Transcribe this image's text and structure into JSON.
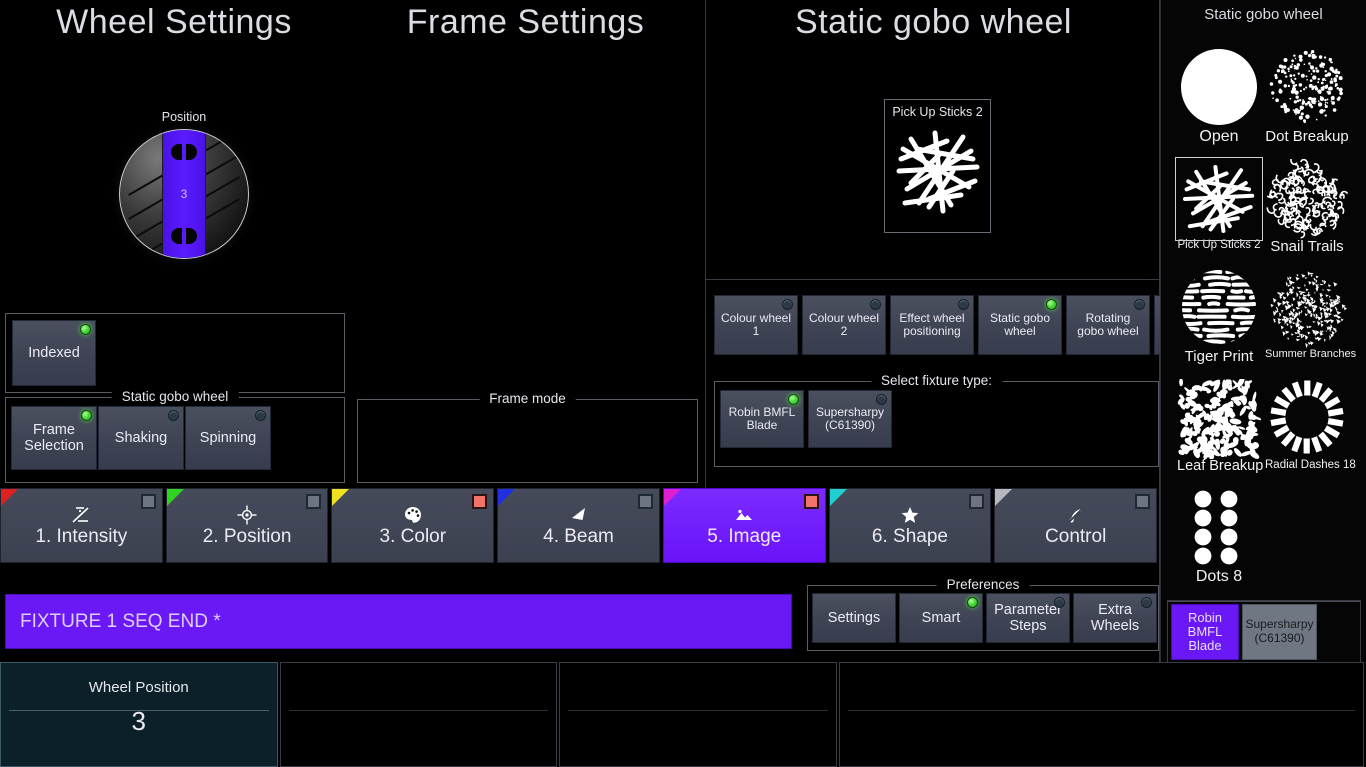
{
  "panels": {
    "wheel_settings": {
      "title": "Wheel Settings"
    },
    "frame_settings": {
      "title": "Frame Settings"
    },
    "static_gobo_wheel": {
      "title": "Static gobo wheel"
    }
  },
  "wheel": {
    "label": "Position",
    "value": "3",
    "highlight_color": "#5a1bff"
  },
  "wheel_mode_group": {
    "buttons": [
      {
        "label": "Indexed",
        "led": "on"
      }
    ]
  },
  "static_gobo_group": {
    "caption": "Static gobo wheel",
    "buttons": [
      {
        "label": "Frame Selection",
        "led": "on"
      },
      {
        "label": "Shaking",
        "led": "off"
      },
      {
        "label": "Spinning",
        "led": "off"
      }
    ]
  },
  "frame_mode_group": {
    "caption": "Frame mode",
    "buttons": []
  },
  "gobo_preview": {
    "name": "Pick Up Sticks 2"
  },
  "wheel_selector": {
    "buttons": [
      {
        "label": "Colour wheel 1",
        "led": "off"
      },
      {
        "label": "Colour wheel 2",
        "led": "off"
      },
      {
        "label": "Effect wheel positioning",
        "led": "off"
      },
      {
        "label": "Static gobo wheel",
        "led": "on"
      },
      {
        "label": "Rotating gobo wheel",
        "led": "off"
      },
      {
        "label": "",
        "led": "none"
      }
    ]
  },
  "fixture_type_group": {
    "caption": "Select fixture type:",
    "buttons": [
      {
        "label": "Robin BMFL Blade",
        "led": "on"
      },
      {
        "label": "Supersharpy (C61390)",
        "led": "off"
      }
    ]
  },
  "sidebar": {
    "title": "Static gobo wheel",
    "gobos": [
      {
        "name": "Open",
        "art": "open",
        "selected": false,
        "font": 16
      },
      {
        "name": "Dot Breakup",
        "art": "dots-scatter",
        "selected": false,
        "font": 15
      },
      {
        "name": "Pick Up Sticks 2",
        "art": "sticks",
        "selected": true,
        "font": 11.5
      },
      {
        "name": "Snail Trails",
        "art": "snail",
        "selected": false,
        "font": 15
      },
      {
        "name": "Tiger Print",
        "art": "tiger",
        "selected": false,
        "font": 15
      },
      {
        "name": "Summer Branches",
        "art": "branches",
        "selected": false,
        "font": 11
      },
      {
        "name": "Leaf Breakup",
        "art": "leaf",
        "selected": false,
        "font": 14.5
      },
      {
        "name": "Radial Dashes 18",
        "art": "radial-dashes",
        "selected": false,
        "font": 11.5
      },
      {
        "name": "Dots 8",
        "art": "dots8",
        "selected": false,
        "font": 16
      }
    ],
    "fixture_buttons": [
      {
        "label": "Robin BMFL Blade",
        "active": true
      },
      {
        "label": "Supersharpy (C61390)",
        "active": false
      }
    ]
  },
  "tabs": [
    {
      "label": "1. Intensity",
      "icon": "intensity-icon",
      "corner": "#e02020",
      "indicator": "grey",
      "active": false
    },
    {
      "label": "2. Position",
      "icon": "position-icon",
      "corner": "#2fd41f",
      "indicator": "grey",
      "active": false
    },
    {
      "label": "3. Color",
      "icon": "palette-icon",
      "corner": "#f0e020",
      "indicator": "red",
      "active": false
    },
    {
      "label": "4. Beam",
      "icon": "beam-icon",
      "corner": "#2030e0",
      "indicator": "grey",
      "active": false
    },
    {
      "label": "5. Image",
      "icon": "image-icon",
      "corner": "#e020d0",
      "indicator": "red",
      "active": true
    },
    {
      "label": "6. Shape",
      "icon": "star-icon",
      "corner": "#20d0d0",
      "indicator": "grey",
      "active": false
    },
    {
      "label": "Control",
      "icon": "control-icon",
      "corner": "#b8b8c0",
      "indicator": "grey",
      "active": false
    }
  ],
  "sequence_bar": {
    "text": "FIXTURE 1 SEQ END *",
    "color": "#6a18f5"
  },
  "preferences": {
    "caption": "Preferences",
    "buttons": [
      {
        "label": "Settings",
        "led": "none"
      },
      {
        "label": "Smart",
        "led": "on"
      },
      {
        "label": "Parameter Steps",
        "led": "off"
      },
      {
        "label": "Extra Wheels",
        "led": "off"
      }
    ]
  },
  "encoders": [
    {
      "name": "Wheel Position",
      "value": "3",
      "filled": true
    },
    {
      "name": "",
      "value": "",
      "filled": false
    },
    {
      "name": "",
      "value": "",
      "filled": false
    },
    {
      "name": "",
      "value": "",
      "filled": false
    }
  ]
}
